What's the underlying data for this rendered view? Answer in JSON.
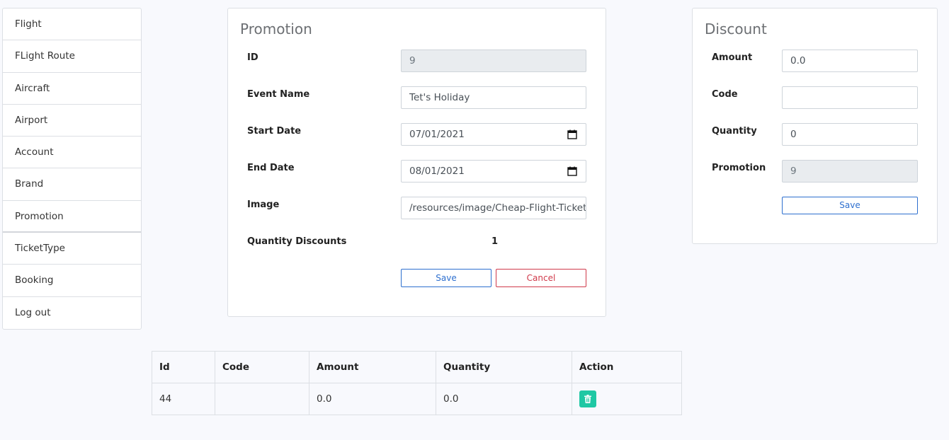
{
  "sidebar": {
    "items": [
      {
        "label": "Flight"
      },
      {
        "label": "FLight Route"
      },
      {
        "label": "Aircraft"
      },
      {
        "label": "Airport"
      },
      {
        "label": "Account"
      },
      {
        "label": "Brand"
      },
      {
        "label": "Promotion"
      },
      {
        "label": "TicketType"
      },
      {
        "label": "Booking"
      },
      {
        "label": "Log out"
      }
    ]
  },
  "promotion": {
    "title": "Promotion",
    "id_label": "ID",
    "id_value": "9",
    "event_name_label": "Event Name",
    "event_name_value": "Tet's Holiday",
    "start_date_label": "Start Date",
    "start_date_value": "07/01/2021",
    "end_date_label": "End Date",
    "end_date_value": "08/01/2021",
    "image_label": "Image",
    "image_value": "/resources/image/Cheap-Flight-Tickets.jpg",
    "quantity_discounts_label": "Quantity Discounts",
    "quantity_discounts_value": "1",
    "save_label": "Save",
    "cancel_label": "Cancel"
  },
  "discount": {
    "title": "Discount",
    "amount_label": "Amount",
    "amount_value": "0.0",
    "code_label": "Code",
    "code_value": "",
    "quantity_label": "Quantity",
    "quantity_value": "0",
    "promotion_label": "Promotion",
    "promotion_value": "9",
    "save_label": "Save"
  },
  "table": {
    "headers": [
      "Id",
      "Code",
      "Amount",
      "Quantity",
      "Action"
    ],
    "rows": [
      {
        "id": "44",
        "code": "",
        "amount": "0.0",
        "quantity": "0.0"
      }
    ]
  },
  "colors": {
    "accent": "#2d6fcf",
    "danger": "#d0394a",
    "delete_button": "#1fc8a4"
  }
}
